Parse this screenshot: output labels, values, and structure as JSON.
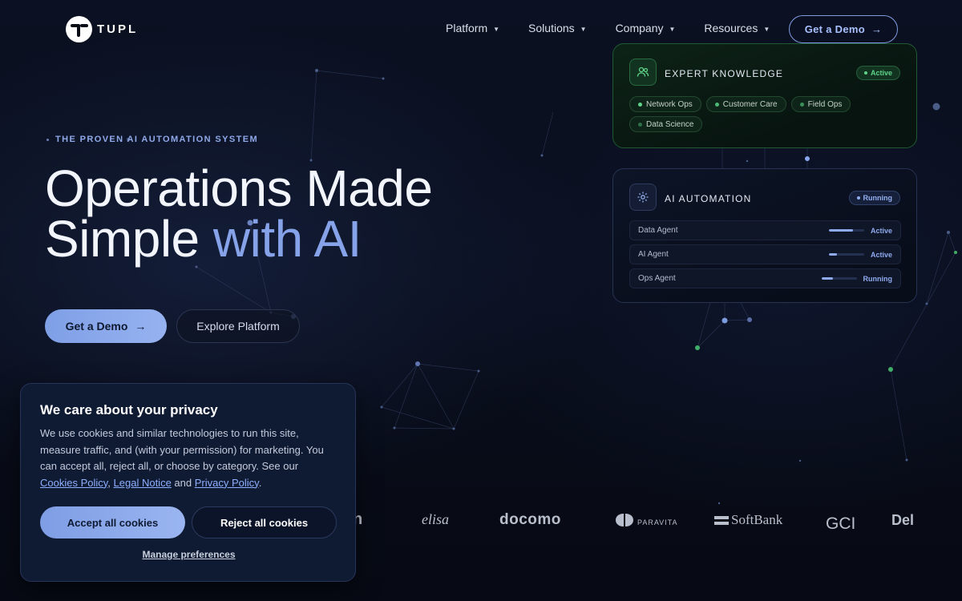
{
  "brand": {
    "name": "TUPL"
  },
  "nav": {
    "items": [
      {
        "label": "Platform"
      },
      {
        "label": "Solutions"
      },
      {
        "label": "Company"
      },
      {
        "label": "Resources"
      }
    ],
    "demo_label": "Get a Demo",
    "arrow": "→"
  },
  "hero": {
    "eyebrow": "THE PROVEN AI AUTOMATION SYSTEM",
    "headline_line1": "Operations Made",
    "headline_line2_plain": "Simple ",
    "headline_line2_accent": "with AI",
    "primary_label": "Get a Demo",
    "secondary_label": "Explore Platform"
  },
  "knowledge_card": {
    "title": "EXPERT KNOWLEDGE",
    "badge": "Active",
    "chips": [
      {
        "label": "Network Ops",
        "dot_color": "#5fd48a"
      },
      {
        "label": "Customer Care",
        "dot_color": "#4cb874"
      },
      {
        "label": "Field Ops",
        "dot_color": "#3a8f5a"
      },
      {
        "label": "Data Science",
        "dot_color": "#2f7048"
      }
    ]
  },
  "automation_card": {
    "title": "AI AUTOMATION",
    "badge": "Running",
    "agents": [
      {
        "name": "Data Agent",
        "progress": 0.68,
        "status": "Active"
      },
      {
        "name": "AI Agent",
        "progress": 0.22,
        "status": "Active"
      },
      {
        "name": "Ops Agent",
        "progress": 0.34,
        "status": "Running"
      }
    ]
  },
  "partners": [
    "n",
    "elisa",
    "docomo",
    "PARAVITA",
    "SoftBank",
    "GCI",
    "Del"
  ],
  "cookie": {
    "title": "We care about your privacy",
    "text_before": "We use cookies and similar technologies to run this site, measure traffic, and (with your permission) for marketing. You can accept all, reject all, or choose by category. See our ",
    "link_cookies": "Cookies Policy",
    "sep1": ", ",
    "link_legal": "Legal Notice",
    "sep2": " and ",
    "link_privacy": "Privacy Policy",
    "text_after": ".",
    "accept_label": "Accept all cookies",
    "reject_label": "Reject all cookies",
    "manage_label": "Manage preferences"
  },
  "colors": {
    "accent": "#86a3ea",
    "active_green": "#5fd48a",
    "background": "#070b16"
  }
}
